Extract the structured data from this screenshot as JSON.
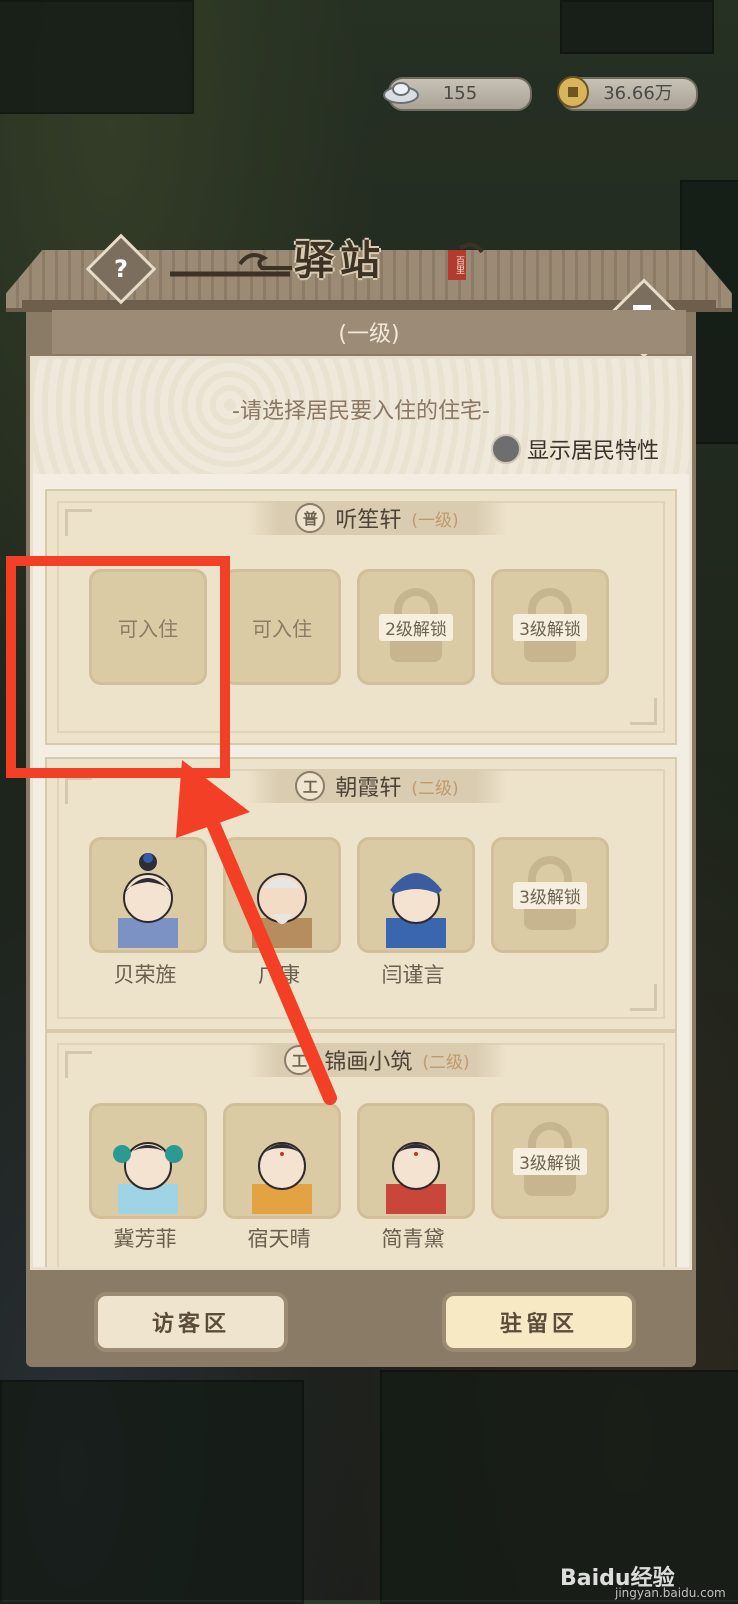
{
  "currency": {
    "silver": "155",
    "coins": "36.66万"
  },
  "panel": {
    "title": "驿站",
    "seal_text": "百里",
    "level": "(一级)",
    "prompt": "-请选择居民要入住的住宅-",
    "toggle_label": "显示居民特性"
  },
  "sections": [
    {
      "badge": "普",
      "name": "听笙轩",
      "level": "(一级)",
      "slots": [
        {
          "type": "empty",
          "label": "可入住"
        },
        {
          "type": "empty",
          "label": "可入住"
        },
        {
          "type": "locked",
          "label": "2级解锁"
        },
        {
          "type": "locked",
          "label": "3级解锁"
        }
      ]
    },
    {
      "badge": "工",
      "name": "朝霞轩",
      "level": "(二级)",
      "slots": [
        {
          "type": "resident",
          "name": "贝荣旌"
        },
        {
          "type": "resident",
          "name": "广康"
        },
        {
          "type": "resident",
          "name": "闫谨言"
        },
        {
          "type": "locked",
          "label": "3级解锁"
        }
      ]
    },
    {
      "badge": "工",
      "name": "锦画小筑",
      "level": "(二级)",
      "slots": [
        {
          "type": "resident",
          "name": "冀芳菲"
        },
        {
          "type": "resident",
          "name": "宿天晴"
        },
        {
          "type": "resident",
          "name": "简青黛"
        },
        {
          "type": "locked",
          "label": "3级解锁"
        }
      ]
    }
  ],
  "bottom": {
    "visitor": "访客区",
    "stay": "驻留区"
  },
  "watermark": {
    "brand": "Baidu经验",
    "url": "jingyan.baidu.com"
  },
  "colors": {
    "annotation_red": "#f23f25",
    "panel_brown": "#8a7b67",
    "content_bg": "#f3eee1"
  }
}
